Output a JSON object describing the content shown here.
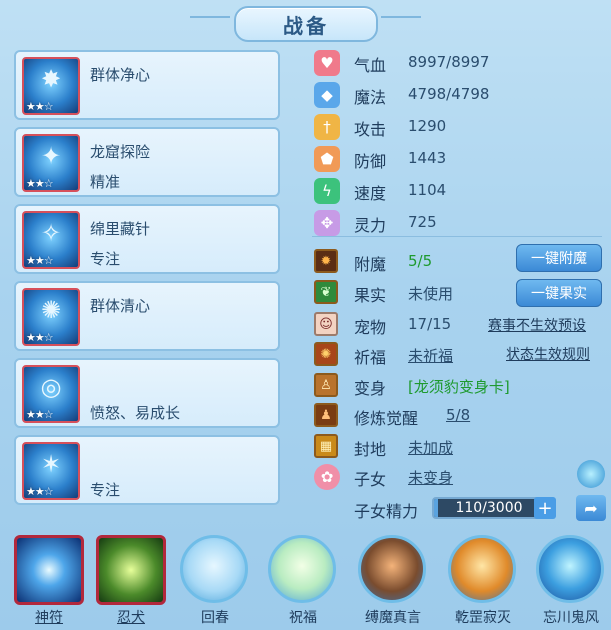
{
  "title": "战备",
  "skills": [
    {
      "name": "群体净心",
      "desc": "",
      "glyph": "✸",
      "stars": "★★☆"
    },
    {
      "name": "龙窟探险",
      "desc": "精准",
      "glyph": "✦",
      "stars": "★★☆"
    },
    {
      "name": "绵里藏针",
      "desc": "专注",
      "glyph": "✧",
      "stars": "★★☆"
    },
    {
      "name": "群体清心",
      "desc": "",
      "glyph": "✺",
      "stars": "★★☆"
    },
    {
      "name": "",
      "desc": "愤怒、易成长",
      "glyph": "◎",
      "stars": "★★☆"
    },
    {
      "name": "",
      "desc": "专注",
      "glyph": "✶",
      "stars": "★★☆"
    }
  ],
  "stats": [
    {
      "label": "气血",
      "value": "8997/8997",
      "icon": "heart-icon",
      "color": "#f07a8b",
      "glyph": "♥"
    },
    {
      "label": "魔法",
      "value": "4798/4798",
      "icon": "shield-icon",
      "color": "#5aa7ea",
      "glyph": "◆"
    },
    {
      "label": "攻击",
      "value": "1290",
      "icon": "sword-icon",
      "color": "#f0b545",
      "glyph": "†"
    },
    {
      "label": "防御",
      "value": "1443",
      "icon": "shield-icon",
      "color": "#f19a57",
      "glyph": "⬟"
    },
    {
      "label": "速度",
      "value": "1104",
      "icon": "lightning-icon",
      "color": "#3cc27c",
      "glyph": "ϟ"
    },
    {
      "label": "灵力",
      "value": "725",
      "icon": "diamond-icon",
      "color": "#c79be6",
      "glyph": "✥"
    }
  ],
  "extra": {
    "fumo": {
      "label": "附魔",
      "value": "5/5"
    },
    "guoshi": {
      "label": "果实",
      "value": "未使用"
    },
    "pet": {
      "label": "宠物",
      "value": "17/15"
    },
    "qifu": {
      "label": "祈福",
      "value": "未祈福"
    },
    "bianshen": {
      "label": "变身",
      "value": "[龙须豹变身卡]"
    },
    "xiulian": {
      "label": "修炼觉醒",
      "value": "5/8"
    },
    "fengdi": {
      "label": "封地",
      "value": "未加成"
    },
    "zinv": {
      "label": "子女",
      "value": "未变身"
    },
    "zinv_jingli": {
      "label": "子女精力",
      "value": "110/3000",
      "fraction": 0.0367
    }
  },
  "buttons": {
    "fumo_btn": "一键附魔",
    "guoshi_btn": "一键果实"
  },
  "links": {
    "pet_link": "赛事不生效预设",
    "qifu_link": "状态生效规则"
  },
  "bottom": [
    {
      "label": "神符",
      "style": "square",
      "underline": true
    },
    {
      "label": "忍犬",
      "style": "square",
      "underline": true
    },
    {
      "label": "回春",
      "style": "round",
      "underline": false
    },
    {
      "label": "祝福",
      "style": "round",
      "underline": false
    },
    {
      "label": "缚魔真言",
      "style": "round",
      "underline": false
    },
    {
      "label": "乾罡寂灭",
      "style": "round",
      "underline": false
    },
    {
      "label": "忘川鬼风",
      "style": "round",
      "underline": false
    }
  ],
  "colors": {
    "accent": "#3b89d6",
    "danger": "#b2283c",
    "green": "#1e9a2f"
  }
}
